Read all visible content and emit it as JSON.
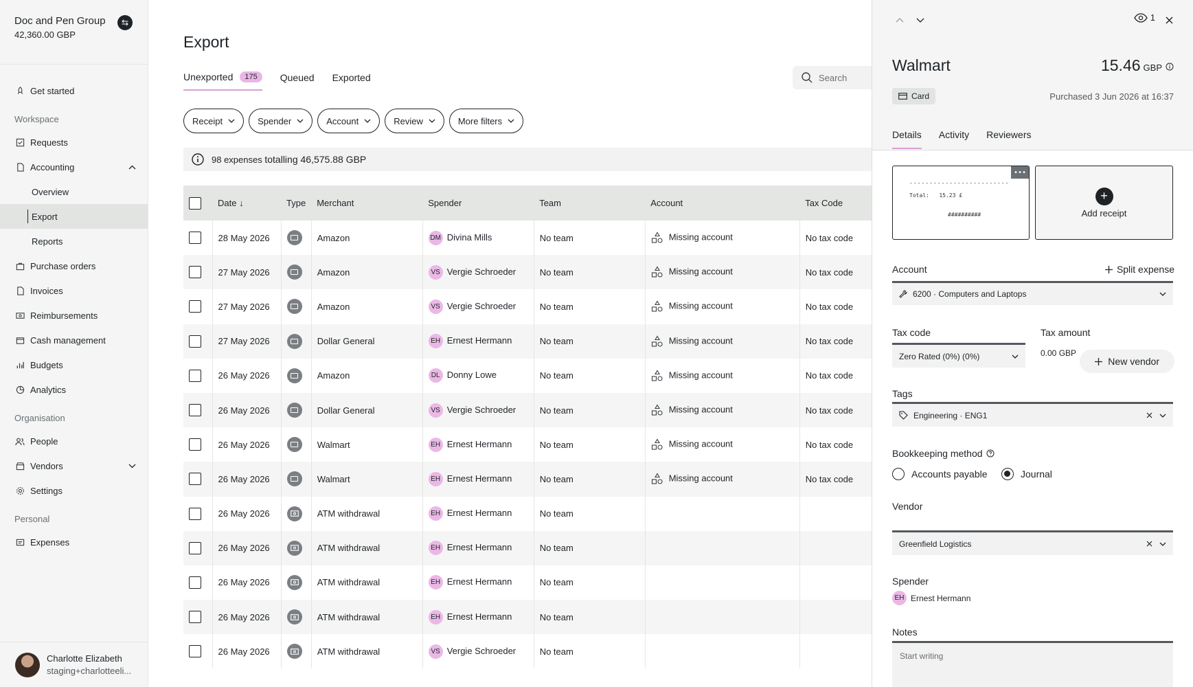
{
  "org": {
    "name": "Doc and Pen Group",
    "balance": "42,360.00 GBP"
  },
  "nav": {
    "get_started": "Get started",
    "workspace_label": "Workspace",
    "requests": "Requests",
    "accounting": "Accounting",
    "overview": "Overview",
    "export": "Export",
    "reports": "Reports",
    "purchase_orders": "Purchase orders",
    "invoices": "Invoices",
    "reimbursements": "Reimbursements",
    "cash_management": "Cash management",
    "budgets": "Budgets",
    "analytics": "Analytics",
    "organisation_label": "Organisation",
    "people": "People",
    "vendors": "Vendors",
    "settings": "Settings",
    "personal_label": "Personal",
    "expenses": "Expenses"
  },
  "user": {
    "name": "Charlotte Elizabeth",
    "email": "staging+charlotteeli..."
  },
  "page": {
    "title": "Export",
    "tabs": {
      "unexported": "Unexported",
      "unexported_count": "175",
      "queued": "Queued",
      "exported": "Exported"
    },
    "search_placeholder": "Search",
    "filters": {
      "receipt": "Receipt",
      "spender": "Spender",
      "account": "Account",
      "review": "Review",
      "more": "More filters"
    },
    "summary_count": "98 expenses",
    "summary_total": "totalling 46,575.88 GBP"
  },
  "table": {
    "headers": {
      "date": "Date",
      "type": "Type",
      "merchant": "Merchant",
      "spender": "Spender",
      "team": "Team",
      "account": "Account",
      "tax_code": "Tax Code"
    },
    "rows": [
      {
        "date": "28 May 2026",
        "type": "card",
        "merchant": "Amazon",
        "initials": "DM",
        "spender": "Divina Mills",
        "team": "No team",
        "account": "Missing account",
        "tax": "No tax code"
      },
      {
        "date": "27 May 2026",
        "type": "card",
        "merchant": "Amazon",
        "initials": "VS",
        "spender": "Vergie Schroeder",
        "team": "No team",
        "account": "Missing account",
        "tax": "No tax code"
      },
      {
        "date": "27 May 2026",
        "type": "card",
        "merchant": "Amazon",
        "initials": "VS",
        "spender": "Vergie Schroeder",
        "team": "No team",
        "account": "Missing account",
        "tax": "No tax code"
      },
      {
        "date": "27 May 2026",
        "type": "card",
        "merchant": "Dollar General",
        "initials": "EH",
        "spender": "Ernest Hermann",
        "team": "No team",
        "account": "Missing account",
        "tax": "No tax code"
      },
      {
        "date": "26 May 2026",
        "type": "card",
        "merchant": "Amazon",
        "initials": "DL",
        "spender": "Donny Lowe",
        "team": "No team",
        "account": "Missing account",
        "tax": "No tax code"
      },
      {
        "date": "26 May 2026",
        "type": "card",
        "merchant": "Dollar General",
        "initials": "VS",
        "spender": "Vergie Schroeder",
        "team": "No team",
        "account": "Missing account",
        "tax": "No tax code"
      },
      {
        "date": "26 May 2026",
        "type": "card",
        "merchant": "Walmart",
        "initials": "EH",
        "spender": "Ernest Hermann",
        "team": "No team",
        "account": "Missing account",
        "tax": "No tax code"
      },
      {
        "date": "26 May 2026",
        "type": "card",
        "merchant": "Walmart",
        "initials": "EH",
        "spender": "Ernest Hermann",
        "team": "No team",
        "account": "Missing account",
        "tax": "No tax code"
      },
      {
        "date": "26 May 2026",
        "type": "cash",
        "merchant": "ATM withdrawal",
        "initials": "EH",
        "spender": "Ernest Hermann",
        "team": "No team",
        "account": "",
        "tax": ""
      },
      {
        "date": "26 May 2026",
        "type": "cash",
        "merchant": "ATM withdrawal",
        "initials": "EH",
        "spender": "Ernest Hermann",
        "team": "No team",
        "account": "",
        "tax": ""
      },
      {
        "date": "26 May 2026",
        "type": "cash",
        "merchant": "ATM withdrawal",
        "initials": "EH",
        "spender": "Ernest Hermann",
        "team": "No team",
        "account": "",
        "tax": ""
      },
      {
        "date": "26 May 2026",
        "type": "cash",
        "merchant": "ATM withdrawal",
        "initials": "EH",
        "spender": "Ernest Hermann",
        "team": "No team",
        "account": "",
        "tax": ""
      },
      {
        "date": "26 May 2026",
        "type": "cash",
        "merchant": "ATM withdrawal",
        "initials": "VS",
        "spender": "Vergie Schroeder",
        "team": "No team",
        "account": "",
        "tax": ""
      }
    ]
  },
  "panel": {
    "viewers": "1",
    "merchant": "Walmart",
    "amount": "15.46",
    "currency": "GBP",
    "card_label": "Card",
    "purchased": "Purchased 3 Jun 2026 at 16:37",
    "tabs": {
      "details": "Details",
      "activity": "Activity",
      "reviewers": "Reviewers"
    },
    "receipt_total_label": "Total:",
    "receipt_total_value": "15.23 £",
    "receipt_stars": "##########",
    "add_receipt": "Add receipt",
    "account_label": "Account",
    "split_expense": "Split expense",
    "account_value": "6200 · Computers and Laptops",
    "tax_code_label": "Tax code",
    "tax_code_value": "Zero Rated (0%) (0%)",
    "tax_amount_label": "Tax amount",
    "tax_amount_value": "0.00 GBP",
    "tags_label": "Tags",
    "tags_value": "Engineering · ENG1",
    "bookkeeping_label": "Bookkeeping method",
    "accounts_payable": "Accounts payable",
    "journal": "Journal",
    "vendor_label": "Vendor",
    "new_vendor": "New vendor",
    "vendor_value": "Greenfield Logistics",
    "spender_label": "Spender",
    "spender_initials": "EH",
    "spender_name": "Ernest Hermann",
    "notes_label": "Notes",
    "notes_placeholder": "Start writing"
  },
  "colors": {
    "accent": "#e9b6e5",
    "sidebar_bg": "#f4f5f4",
    "header_bg": "#e4e6e4"
  }
}
